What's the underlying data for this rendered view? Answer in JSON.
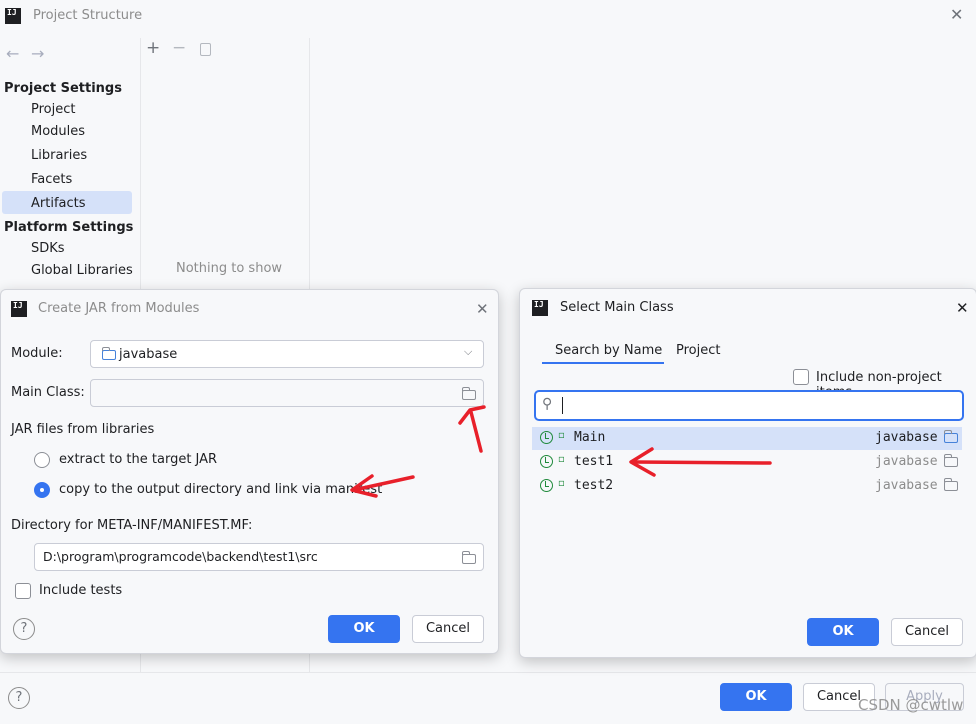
{
  "main_window": {
    "title": "Project Structure",
    "sidebar": {
      "project_settings_header": "Project Settings",
      "project_settings_items": [
        "Project",
        "Modules",
        "Libraries",
        "Facets",
        "Artifacts"
      ],
      "platform_settings_header": "Platform Settings",
      "platform_settings_items": [
        "SDKs",
        "Global Libraries"
      ],
      "selected": "Artifacts"
    },
    "empty_text": "Nothing to show",
    "buttons": {
      "ok": "OK",
      "cancel": "Cancel",
      "apply": "Apply"
    },
    "watermark": "CSDN @cwtlw"
  },
  "create_jar_dialog": {
    "title": "Create JAR from Modules",
    "module_label": "Module:",
    "module_value": "javabase",
    "main_class_label": "Main Class:",
    "main_class_value": "",
    "jar_files_label": "JAR files from libraries",
    "radio_extract": "extract to the target JAR",
    "radio_copy": "copy to the output directory and link via manifest",
    "selected_radio": "copy",
    "directory_label": "Directory for META-INF/MANIFEST.MF:",
    "directory_value": "D:\\program\\programcode\\backend\\test1\\src",
    "include_tests_label": "Include tests",
    "include_tests_checked": false,
    "ok": "OK",
    "cancel": "Cancel"
  },
  "select_main_class_dialog": {
    "title": "Select Main Class",
    "tabs": [
      "Search by Name",
      "Project"
    ],
    "active_tab": "Search by Name",
    "include_non_project_label": "Include non-project items",
    "include_non_project_checked": false,
    "search_value": "",
    "classes": [
      {
        "name": "Main",
        "module": "javabase",
        "selected": true
      },
      {
        "name": "test1",
        "module": "javabase",
        "selected": false
      },
      {
        "name": "test2",
        "module": "javabase",
        "selected": false
      }
    ],
    "ok": "OK",
    "cancel": "Cancel"
  },
  "colors": {
    "accent": "#3574f0",
    "selection": "#d5e1f9",
    "annotation_arrow": "#e8202a"
  }
}
